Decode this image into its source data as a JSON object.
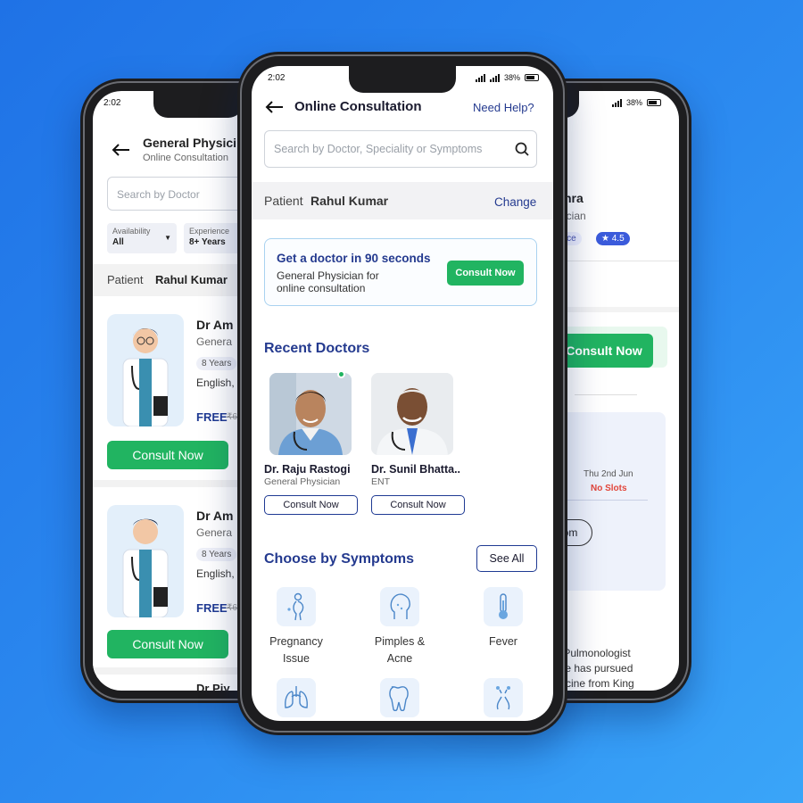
{
  "left": {
    "status_time": "2:02",
    "title": "General Physici",
    "subtitle": "Online Consultation",
    "search_placeholder": "Search by Doctor",
    "filter1_label": "Availability",
    "filter1_value": "All",
    "filter2_label": "Experience",
    "filter2_value": "8+ Years",
    "patient_label": "Patient",
    "patient_name": "Rahul Kumar",
    "doctors": [
      {
        "name": "Dr Am",
        "spec": "Genera",
        "years": "8 Years",
        "lang": "English,",
        "price": "FREE",
        "strike": "₹6",
        "button": "Consult Now"
      },
      {
        "name": "Dr Am",
        "spec": "Genera",
        "years": "8 Years",
        "lang": "English,",
        "price": "FREE",
        "strike": "₹6",
        "button": "Consult Now"
      }
    ],
    "next_doctor": "Dr Piy"
  },
  "right": {
    "battery": "38%",
    "name_fragment": "hra",
    "spec_fragment": "ician",
    "exp_fragment": "ence",
    "rating": "4.5",
    "consult_button": "Consult Now",
    "slot_day": "Thu 2nd Jun",
    "slot_status": "No Slots",
    "slot_time": "0 pm",
    "about_lines": [
      "nt Pulmonologist",
      ". He has pursued",
      "edicine from King"
    ]
  },
  "center": {
    "status_time": "2:02",
    "battery": "38%",
    "title": "Online Consultation",
    "help": "Need Help?",
    "search_placeholder": "Search by Doctor, Speciality or Symptoms",
    "patient_label": "Patient",
    "patient_name": "Rahul Kumar",
    "change": "Change",
    "promo_title": "Get a doctor in 90 seconds",
    "promo_sub1": "General Physician for",
    "promo_sub2": "online consultation",
    "promo_button": "Consult Now",
    "recent_heading": "Recent Doctors",
    "recent": [
      {
        "name": "Dr. Raju Rastogi",
        "spec": "General Physician",
        "button": "Consult Now"
      },
      {
        "name": "Dr. Sunil Bhatta..",
        "spec": "ENT",
        "button": "Consult Now"
      }
    ],
    "symptoms_heading": "Choose by Symptoms",
    "see_all": "See All",
    "symptoms": [
      {
        "line1": "Pregnancy",
        "line2": "Issue",
        "icon": "pregnancy-icon"
      },
      {
        "line1": "Pimples &",
        "line2": "Acne",
        "icon": "pimples-icon"
      },
      {
        "line1": "Fever",
        "line2": "",
        "icon": "thermometer-icon"
      }
    ],
    "more_symptom_icons": [
      "lungs-icon",
      "tooth-icon",
      "nose-icon"
    ]
  },
  "colors": {
    "accent_green": "#21b461",
    "navy": "#243a8f",
    "background": "#2c8bf0"
  }
}
